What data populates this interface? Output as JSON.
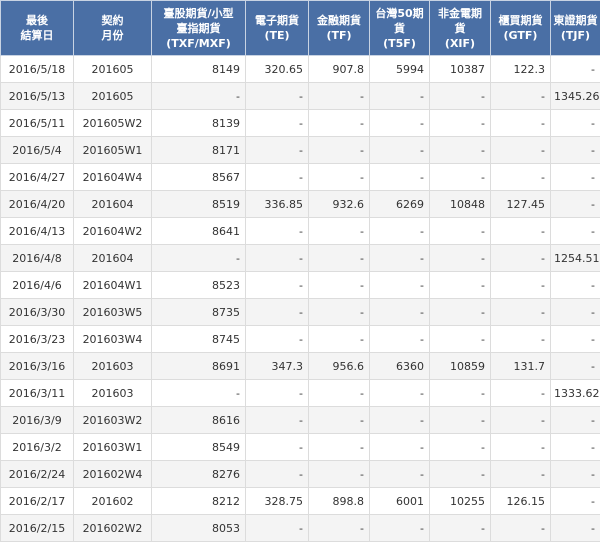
{
  "table": {
    "headers": [
      [
        "最後",
        "結算日"
      ],
      [
        "契約",
        "月份"
      ],
      [
        "臺股期貨/小型",
        "臺指期貨",
        "(TXF/MXF)"
      ],
      [
        "電子期貨",
        "(TE)"
      ],
      [
        "金融期貨",
        "(TF)"
      ],
      [
        "台灣50期",
        "貨",
        "(T5F)"
      ],
      [
        "非金電期",
        "貨",
        "(XIF)"
      ],
      [
        "櫃買期貨",
        "(GTF)"
      ],
      [
        "東證期貨",
        "(TJF)"
      ]
    ],
    "rows": [
      [
        "2016/5/18",
        "201605",
        "8149",
        "320.65",
        "907.8",
        "5994",
        "10387",
        "122.3",
        "-"
      ],
      [
        "2016/5/13",
        "201605",
        "-",
        "-",
        "-",
        "-",
        "-",
        "-",
        "1345.26"
      ],
      [
        "2016/5/11",
        "201605W2",
        "8139",
        "-",
        "-",
        "-",
        "-",
        "-",
        "-"
      ],
      [
        "2016/5/4",
        "201605W1",
        "8171",
        "-",
        "-",
        "-",
        "-",
        "-",
        "-"
      ],
      [
        "2016/4/27",
        "201604W4",
        "8567",
        "-",
        "-",
        "-",
        "-",
        "-",
        "-"
      ],
      [
        "2016/4/20",
        "201604",
        "8519",
        "336.85",
        "932.6",
        "6269",
        "10848",
        "127.45",
        "-"
      ],
      [
        "2016/4/13",
        "201604W2",
        "8641",
        "-",
        "-",
        "-",
        "-",
        "-",
        "-"
      ],
      [
        "2016/4/8",
        "201604",
        "-",
        "-",
        "-",
        "-",
        "-",
        "-",
        "1254.51"
      ],
      [
        "2016/4/6",
        "201604W1",
        "8523",
        "-",
        "-",
        "-",
        "-",
        "-",
        "-"
      ],
      [
        "2016/3/30",
        "201603W5",
        "8735",
        "-",
        "-",
        "-",
        "-",
        "-",
        "-"
      ],
      [
        "2016/3/23",
        "201603W4",
        "8745",
        "-",
        "-",
        "-",
        "-",
        "-",
        "-"
      ],
      [
        "2016/3/16",
        "201603",
        "8691",
        "347.3",
        "956.6",
        "6360",
        "10859",
        "131.7",
        "-"
      ],
      [
        "2016/3/11",
        "201603",
        "-",
        "-",
        "-",
        "-",
        "-",
        "-",
        "1333.62"
      ],
      [
        "2016/3/9",
        "201603W2",
        "8616",
        "-",
        "-",
        "-",
        "-",
        "-",
        "-"
      ],
      [
        "2016/3/2",
        "201603W1",
        "8549",
        "-",
        "-",
        "-",
        "-",
        "-",
        "-"
      ],
      [
        "2016/2/24",
        "201602W4",
        "8276",
        "-",
        "-",
        "-",
        "-",
        "-",
        "-"
      ],
      [
        "2016/2/17",
        "201602",
        "8212",
        "328.75",
        "898.8",
        "6001",
        "10255",
        "126.15",
        "-"
      ],
      [
        "2016/2/15",
        "201602W2",
        "8053",
        "-",
        "-",
        "-",
        "-",
        "-",
        "-"
      ]
    ]
  }
}
